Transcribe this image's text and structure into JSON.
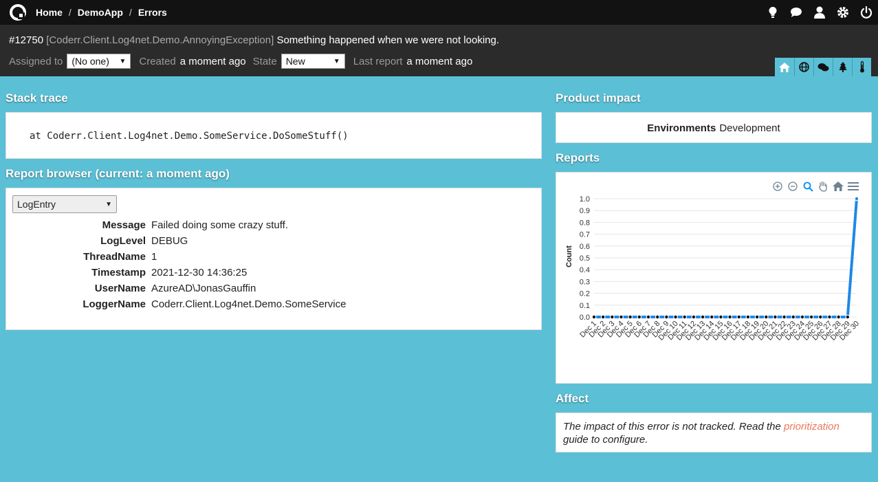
{
  "nav": {
    "breadcrumb": [
      "Home",
      "DemoApp",
      "Errors"
    ],
    "separator": "/",
    "icons": [
      "lightbulb-icon",
      "chat-icon",
      "user-icon",
      "gear-icon",
      "power-icon"
    ]
  },
  "incident": {
    "id": "#12750",
    "exception": "[Coderr.Client.Log4net.Demo.AnnoyingException]",
    "message": "Something happened when we were not looking.",
    "assigned_label": "Assigned to",
    "assigned_value": "(No one)",
    "created_label": "Created",
    "created_value": "a moment ago",
    "state_label": "State",
    "state_value": "New",
    "last_report_label": "Last report",
    "last_report_value": "a moment ago",
    "tabs": [
      "home-icon",
      "globe-icon",
      "chat-icon",
      "tree-icon",
      "thermometer-icon"
    ]
  },
  "stack": {
    "heading": "Stack trace",
    "line": "at Coderr.Client.Log4net.Demo.SomeService.DoSomeStuff()"
  },
  "report_browser": {
    "heading": "Report browser (current: a moment ago)",
    "select_value": "LogEntry",
    "rows": [
      {
        "key": "Message",
        "value": "Failed doing some crazy stuff."
      },
      {
        "key": "LogLevel",
        "value": "DEBUG"
      },
      {
        "key": "ThreadName",
        "value": "1"
      },
      {
        "key": "Timestamp",
        "value": "2021-12-30 14:36:25"
      },
      {
        "key": "UserName",
        "value": "AzureAD\\JonasGauffin"
      },
      {
        "key": "LoggerName",
        "value": "Coderr.Client.Log4net.Demo.SomeService"
      }
    ]
  },
  "product_impact": {
    "heading": "Product impact",
    "env_label": "Environments",
    "env_value": "Development"
  },
  "reports": {
    "heading": "Reports",
    "toolbar": [
      "zoom-in-icon",
      "zoom-out-icon",
      "zoom-select-icon",
      "pan-icon",
      "reset-home-icon",
      "menu-icon"
    ]
  },
  "affect": {
    "heading": "Affect",
    "text_before": "The impact of this error is not tracked. Read the ",
    "link": "prioritization",
    "text_after": " guide to configure."
  },
  "colors": {
    "background": "#5bc0d6",
    "nav": "#121212",
    "header": "#2b2b2b",
    "series": "#1e88e5",
    "link": "#e8795c"
  },
  "chart_data": {
    "type": "line",
    "ylabel": "Count",
    "xlabel": "",
    "ylim": [
      0,
      1.0
    ],
    "yticks": [
      "0.0",
      "0.1",
      "0.2",
      "0.3",
      "0.4",
      "0.5",
      "0.6",
      "0.7",
      "0.8",
      "0.9",
      "1.0"
    ],
    "categories": [
      "Dec 1",
      "Dec 2",
      "Dec 3",
      "Dec 4",
      "Dec 5",
      "Dec 6",
      "Dec 7",
      "Dec 8",
      "Dec 9",
      "Dec 10",
      "Dec 11",
      "Dec 12",
      "Dec 13",
      "Dec 14",
      "Dec 15",
      "Dec 16",
      "Dec 17",
      "Dec 18",
      "Dec 19",
      "Dec 20",
      "Dec 21",
      "Dec 22",
      "Dec 23",
      "Dec 24",
      "Dec 25",
      "Dec 26",
      "Dec 27",
      "Dec 28",
      "Dec 29",
      "Dec 30"
    ],
    "series": [
      {
        "values": [
          0,
          0,
          0,
          0,
          0,
          0,
          0,
          0,
          0,
          0,
          0,
          0,
          0,
          0,
          0,
          0,
          0,
          0,
          0,
          0,
          0,
          0,
          0,
          0,
          0,
          0,
          0,
          0,
          0,
          1
        ]
      }
    ],
    "grid": true,
    "legend": "none"
  }
}
